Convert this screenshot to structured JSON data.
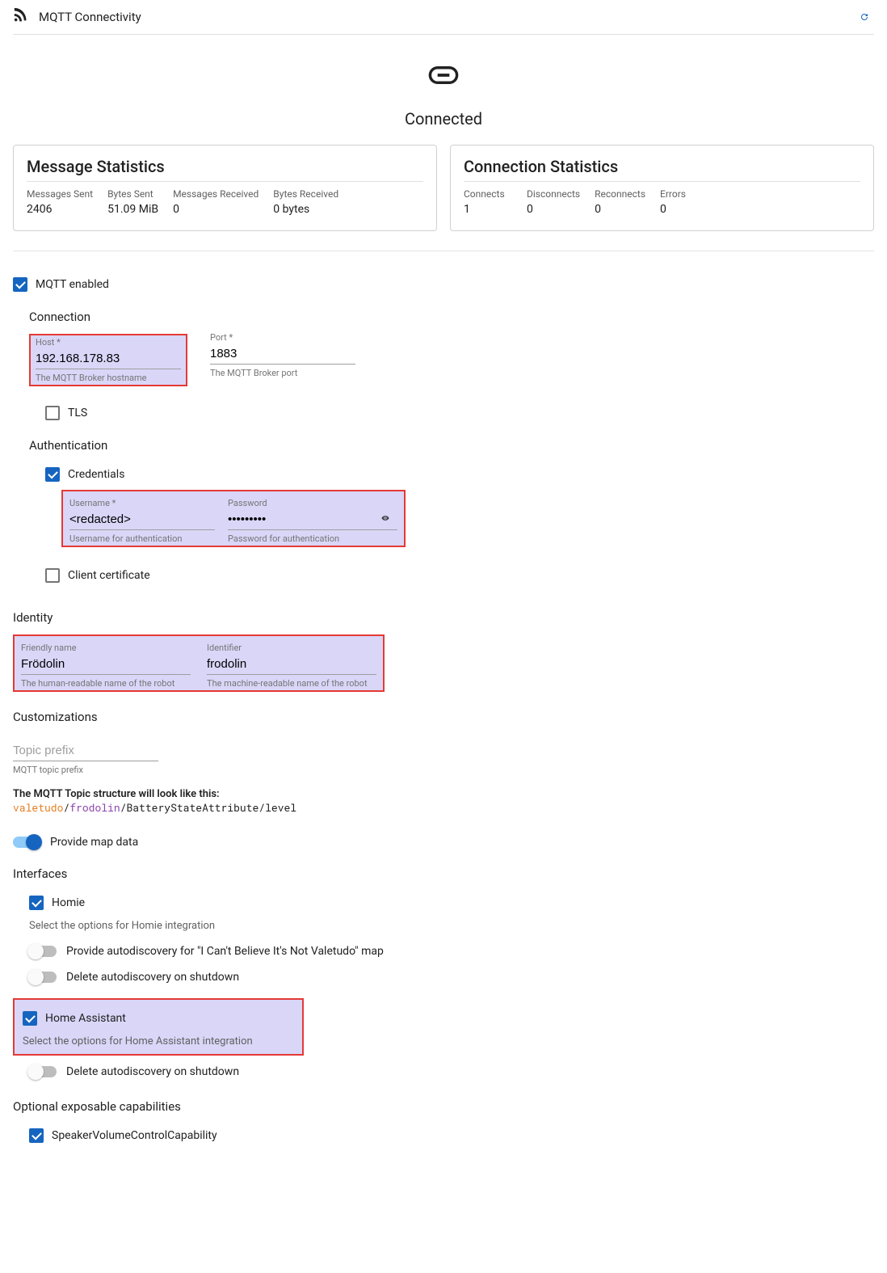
{
  "header": {
    "title": "MQTT Connectivity"
  },
  "status": {
    "label": "Connected"
  },
  "cards": {
    "message_stats": {
      "title": "Message Statistics",
      "cols": [
        "Messages Sent",
        "Bytes Sent",
        "Messages Received",
        "Bytes Received"
      ],
      "vals": [
        "2406",
        "51.09 MiB",
        "0",
        "0 bytes"
      ]
    },
    "conn_stats": {
      "title": "Connection Statistics",
      "cols": [
        "Connects",
        "Disconnects",
        "Reconnects",
        "Errors"
      ],
      "vals": [
        "1",
        "0",
        "0",
        "0"
      ]
    }
  },
  "main_toggle": {
    "label": "MQTT enabled",
    "checked": true
  },
  "connection": {
    "heading": "Connection",
    "host": {
      "label": "Host *",
      "value": "192.168.178.83",
      "helper": "The MQTT Broker hostname"
    },
    "port": {
      "label": "Port *",
      "value": "1883",
      "helper": "The MQTT Broker port"
    },
    "tls": {
      "label": "TLS",
      "checked": false
    },
    "auth": {
      "heading": "Authentication",
      "credentials": {
        "label": "Credentials",
        "checked": true
      },
      "username": {
        "label": "Username *",
        "value": "<redacted>",
        "helper": "Username for authentication"
      },
      "password": {
        "label": "Password",
        "value": "•••••••••",
        "helper": "Password for authentication"
      },
      "client_cert": {
        "label": "Client certificate",
        "checked": false
      }
    }
  },
  "identity": {
    "heading": "Identity",
    "friendly": {
      "label": "Friendly name",
      "value": "Frödolin",
      "helper": "The human-readable name of the robot"
    },
    "identifier": {
      "label": "Identifier",
      "value": "frodolin",
      "helper": "The machine-readable name of the robot"
    }
  },
  "custom": {
    "heading": "Customizations",
    "topic_prefix": {
      "placeholder": "Topic prefix",
      "value": "",
      "helper": "MQTT topic prefix"
    },
    "topic_intro": "The MQTT Topic structure will look like this:",
    "topic_parts": {
      "prefix": "valetudo",
      "sep1": "/",
      "id": "frodolin",
      "rest": "/BatteryStateAttribute/level"
    },
    "provide_map": {
      "label": "Provide map data",
      "on": true
    }
  },
  "interfaces": {
    "heading": "Interfaces",
    "homie": {
      "label": "Homie",
      "checked": true,
      "note": "Select the options for Homie integration",
      "opt1": {
        "label": "Provide autodiscovery for \"I Can't Believe It's Not Valetudo\" map",
        "on": false
      },
      "opt2": {
        "label": "Delete autodiscovery on shutdown",
        "on": false
      }
    },
    "ha": {
      "label": "Home Assistant",
      "checked": true,
      "note": "Select the options for Home Assistant integration",
      "opt1": {
        "label": "Delete autodiscovery on shutdown",
        "on": false
      }
    }
  },
  "optional_caps": {
    "heading": "Optional exposable capabilities",
    "speaker": {
      "label": "SpeakerVolumeControlCapability",
      "checked": true
    }
  }
}
